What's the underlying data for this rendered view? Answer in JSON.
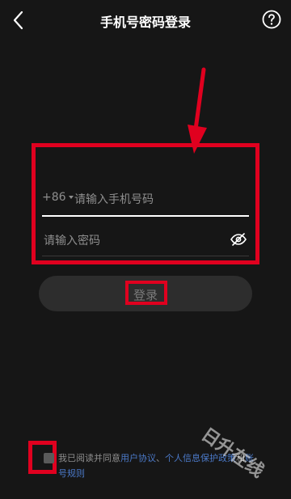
{
  "header": {
    "title": "手机号密码登录"
  },
  "login_form": {
    "country_code": "+86",
    "phone_placeholder": "请输入手机号码",
    "password_placeholder": "请输入密码",
    "login_label": "登录"
  },
  "agreement": {
    "prefix": "我已阅读并同意",
    "user_agreement": "用户协议",
    "sep": "、",
    "privacy_policy": "个人信息保护政策",
    "and": "和",
    "account_rules": "账号规则"
  },
  "watermark": "日升在线",
  "colors": {
    "background": "#161616",
    "highlight": "#e0001f",
    "link": "#4b79c8"
  },
  "icons": {
    "back": "chevron-left-icon",
    "help": "help-circle-icon",
    "password_visibility": "eye-off-icon"
  }
}
